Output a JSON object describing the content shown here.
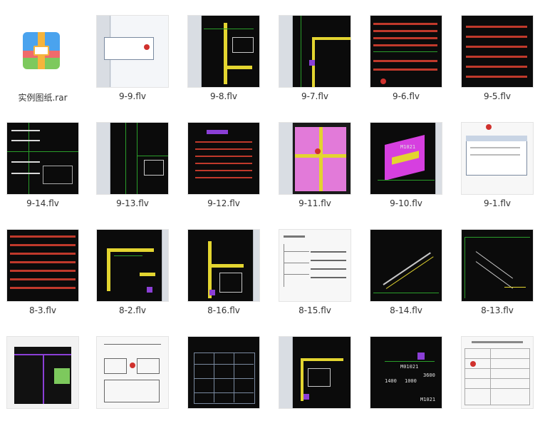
{
  "files": [
    {
      "name": "实例图纸.rar"
    },
    {
      "name": "9-9.flv"
    },
    {
      "name": "9-8.flv"
    },
    {
      "name": "9-7.flv"
    },
    {
      "name": "9-6.flv"
    },
    {
      "name": "9-5.flv"
    },
    {
      "name": "9-14.flv"
    },
    {
      "name": "9-13.flv"
    },
    {
      "name": "9-12.flv"
    },
    {
      "name": "9-11.flv"
    },
    {
      "name": "9-10.flv"
    },
    {
      "name": "9-1.flv"
    },
    {
      "name": "8-3.flv"
    },
    {
      "name": "8-2.flv"
    },
    {
      "name": "8-16.flv"
    },
    {
      "name": "8-15.flv"
    },
    {
      "name": "8-14.flv"
    },
    {
      "name": "8-13.flv"
    }
  ],
  "thumb_text": {
    "t_9_10_label": "M1021",
    "t_last_a": "M01021",
    "t_last_b": "1400",
    "t_last_c": "1000",
    "t_last_d": "M1021",
    "t_last_e": "3600"
  }
}
